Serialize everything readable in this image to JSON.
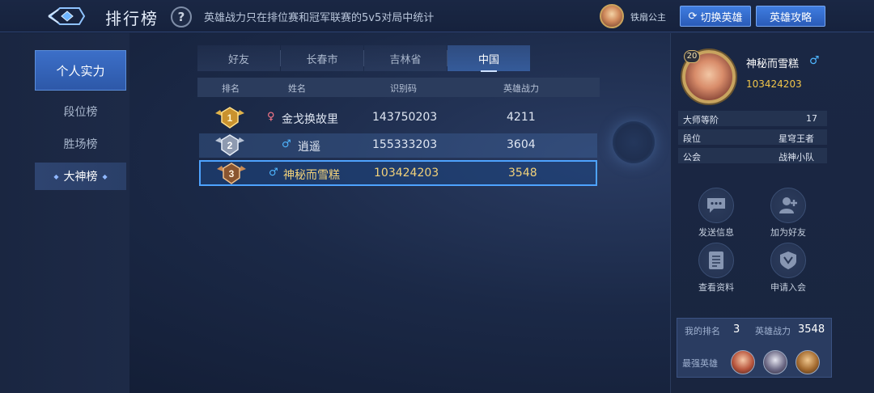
{
  "header": {
    "title": "排行榜",
    "help_label": "?",
    "notice": "英雄战力只在排位赛和冠军联赛的5v5对局中统计",
    "current_hero": "铁扇公主",
    "switch_hero_label": "切换英雄",
    "guide_label": "英雄攻略",
    "accent_color": "#3f7de0"
  },
  "leftnav": {
    "primary": "个人实力",
    "items": [
      "段位榜",
      "胜场榜",
      "大神榜"
    ],
    "active_index": 2
  },
  "tabs": {
    "items": [
      "好友",
      "长春市",
      "吉林省",
      "中国"
    ],
    "active_index": 3
  },
  "table": {
    "headers": [
      "排名",
      "姓名",
      "识别码",
      "英雄战力"
    ],
    "rows": [
      {
        "rank": "1",
        "gender": "female",
        "gender_icon": "♀",
        "name": "金戈换故里",
        "id": "143750203",
        "power": "4211",
        "badge": "gold-rank-icon"
      },
      {
        "rank": "2",
        "gender": "male",
        "gender_icon": "♂",
        "name": "逍遥",
        "id": "155333203",
        "power": "3604",
        "badge": "silver-rank-icon"
      },
      {
        "rank": "3",
        "gender": "male",
        "gender_icon": "♂",
        "name": "神秘而雪糕",
        "id": "103424203",
        "power": "3548",
        "badge": "bronze-rank-icon"
      }
    ],
    "highlight_row": 2,
    "highlight_color": "#4ea3ff"
  },
  "profile": {
    "level": "20",
    "name": "神秘而雪糕",
    "gender_icon": "♂",
    "id": "103424203",
    "info": [
      {
        "key": "大师等阶",
        "value": "17"
      },
      {
        "key": "段位",
        "value": "星穹王者"
      },
      {
        "key": "公会",
        "value": "战神小队"
      }
    ],
    "actions": [
      {
        "label": "发送信息",
        "icon": "message-icon"
      },
      {
        "label": "加为好友",
        "icon": "add-friend-icon"
      },
      {
        "label": "查看资料",
        "icon": "profile-doc-icon"
      },
      {
        "label": "申请入会",
        "icon": "guild-shield-icon"
      }
    ]
  },
  "stats": {
    "my_rank_label": "我的排名",
    "my_rank": "3",
    "power_label": "英雄战力",
    "power": "3548",
    "best_heroes_label": "最强英雄"
  }
}
